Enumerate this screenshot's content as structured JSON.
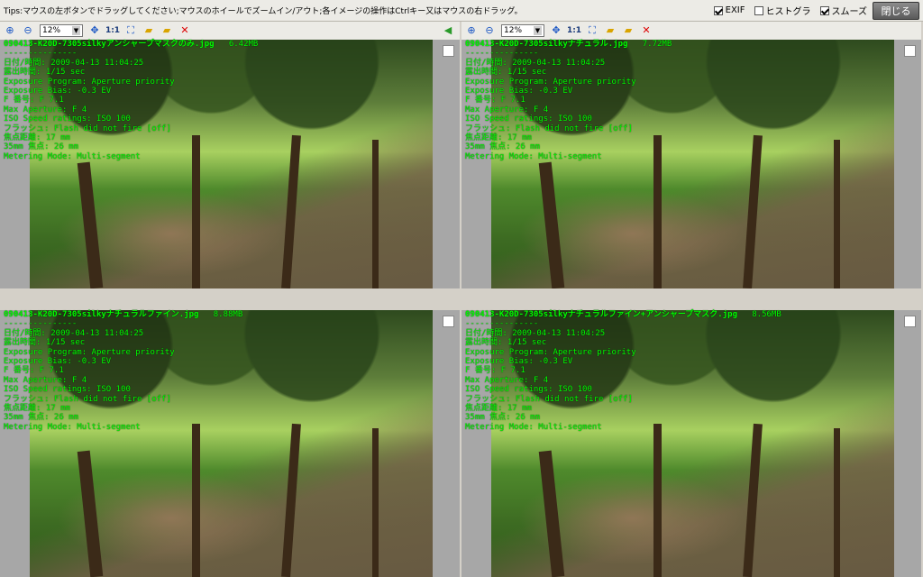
{
  "tips": "Tips:マウスの左ボタンでドラッグしてください;マウスのホイールでズームイン/アウト;各イメージの操作はCtrlキー又はマウスの右ドラッグ。",
  "options": [
    {
      "label": "EXIF",
      "checked": true
    },
    {
      "label": "ヒストグラ",
      "checked": false
    },
    {
      "label": "スムーズ",
      "checked": true
    }
  ],
  "close_label": "閉じる",
  "zoom_value": "12%",
  "toolbar_icons": [
    "zoom-in-icon",
    "zoom-out-icon",
    "fit-icon",
    "actual-size-icon",
    "fullscreen-icon",
    "folder-open-icon",
    "folder-next-icon",
    "delete-icon"
  ],
  "panes": [
    {
      "filename": "090413-K20D-7305silkyアンシャープマスクのみ.jpg",
      "size": "6.42MB",
      "exif": [
        "日付/時間: 2009-04-13 11:04:25",
        "露出時間: 1/15 sec",
        "Exposure Program: Aperture priority",
        "Exposure Bias: -0.3 EV",
        "F 番号: F 7.1",
        "Max Aperture: F 4",
        "ISO Speed ratings: ISO 100",
        "フラッシュ: Flash did not fire [off]",
        "焦点距離: 17 mm",
        "35mm 焦点: 26 mm",
        "Metering Mode: Multi-segment"
      ]
    },
    {
      "filename": "090413-K20D-7305silkyナチュラル.jpg",
      "size": "7.72MB",
      "exif": [
        "日付/時間: 2009-04-13 11:04:25",
        "露出時間: 1/15 sec",
        "Exposure Program: Aperture priority",
        "Exposure Bias: -0.3 EV",
        "F 番号: F 7.1",
        "Max Aperture: F 4",
        "ISO Speed ratings: ISO 100",
        "フラッシュ: Flash did not fire [off]",
        "焦点距離: 17 mm",
        "35mm 焦点: 26 mm",
        "Metering Mode: Multi-segment"
      ]
    },
    {
      "filename": "090413-K20D-7305silkyナチュラルファイン.jpg",
      "size": "8.88MB",
      "exif": [
        "日付/時間: 2009-04-13 11:04:25",
        "露出時間: 1/15 sec",
        "Exposure Program: Aperture priority",
        "Exposure Bias: -0.3 EV",
        "F 番号: F 7.1",
        "Max Aperture: F 4",
        "ISO Speed ratings: ISO 100",
        "フラッシュ: Flash did not fire [off]",
        "焦点距離: 17 mm",
        "35mm 焦点: 26 mm",
        "Metering Mode: Multi-segment"
      ]
    },
    {
      "filename": "090413-K20D-7305silkyナチュラルファイン+アンシャープマスク.jpg",
      "size": "8.56MB",
      "exif": [
        "日付/時間: 2009-04-13 11:04:25",
        "露出時間: 1/15 sec",
        "Exposure Program: Aperture priority",
        "Exposure Bias: -0.3 EV",
        "F 番号: F 7.1",
        "Max Aperture: F 4",
        "ISO Speed ratings: ISO 100",
        "フラッシュ: Flash did not fire [off]",
        "焦点距離: 17 mm",
        "35mm 焦点: 26 mm",
        "Metering Mode: Multi-segment"
      ]
    }
  ]
}
